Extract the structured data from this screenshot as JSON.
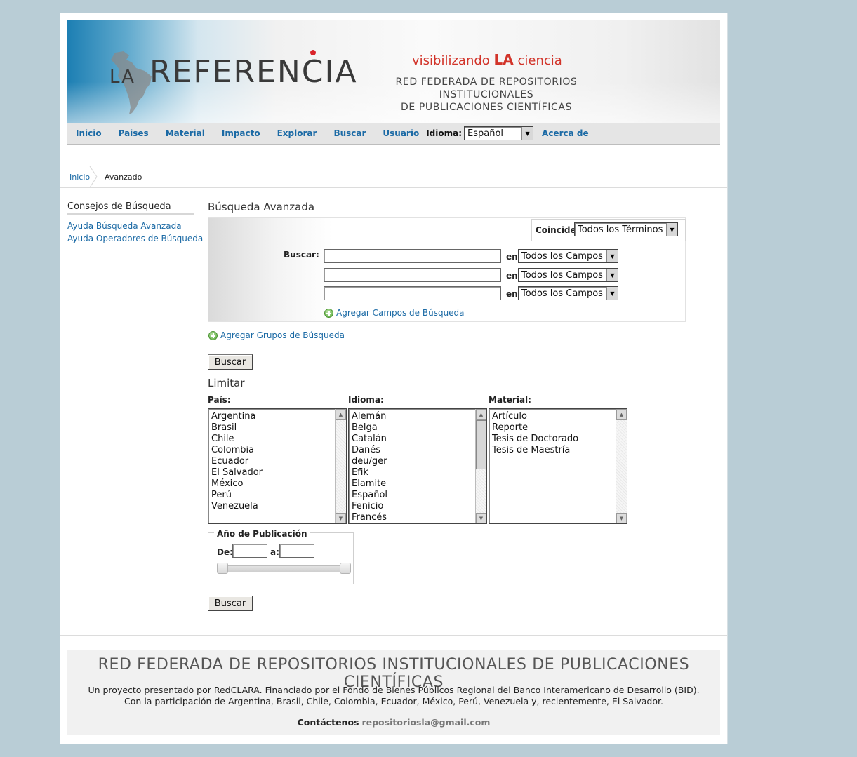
{
  "header": {
    "logo_la": "LA",
    "logo_ref": "REFERENCIA",
    "tagline_a": "visibilizando ",
    "tagline_la": "LA",
    "tagline_b": " ciencia",
    "subtitle_1": "RED FEDERADA DE REPOSITORIOS INSTITUCIONALES",
    "subtitle_2": "DE PUBLICACIONES CIENTÍFICAS",
    "accent_color": "#d2342a"
  },
  "nav": {
    "items": [
      "Inicio",
      "Paises",
      "Material",
      "Impacto",
      "Explorar",
      "Buscar",
      "Usuario"
    ],
    "language_label": "Idioma:",
    "language_value": "Español",
    "about": "Acerca de"
  },
  "breadcrumb": {
    "home": "Inicio",
    "current": "Avanzado"
  },
  "sidebar": {
    "title": "Consejos de Búsqueda",
    "links": [
      "Ayuda Búsqueda Avanzada",
      "Ayuda Operadores de Búsqueda"
    ]
  },
  "search": {
    "title": "Búsqueda Avanzada",
    "coincide_label": "Coincide:",
    "coincide_value": "Todos los Términos",
    "buscar_label": "Buscar:",
    "in_label": "en",
    "field_value": "Todos los Campos",
    "add_fields": "Agregar Campos de Búsqueda",
    "add_groups": "Agregar Grupos de Búsqueda",
    "button": "Buscar"
  },
  "limit": {
    "title": "Limitar",
    "pais_label": "País:",
    "pais": [
      "Argentina",
      "Brasil",
      "Chile",
      "Colombia",
      "Ecuador",
      "El Salvador",
      "México",
      "Perú",
      "Venezuela"
    ],
    "idioma_label": "Idioma:",
    "idioma": [
      "Alemán",
      "Belga",
      "Catalán",
      "Danés",
      "deu/ger",
      "Efik",
      "Elamite",
      "Español",
      "Fenicio",
      "Francés"
    ],
    "material_label": "Material:",
    "material": [
      "Artículo",
      "Reporte",
      "Tesis de Doctorado",
      "Tesis de Maestría"
    ],
    "year_legend": "Año de Publicación",
    "from_label": "De:",
    "to_label": "a:",
    "button": "Buscar"
  },
  "footer": {
    "title": "RED FEDERADA DE REPOSITORIOS INSTITUCIONALES DE PUBLICACIONES CIENTÍFICAS",
    "line1": "Un proyecto presentado por RedCLARA. Financiado por el Fondo de Bienes Públicos Regional del Banco Interamericano de Desarrollo (BID).",
    "line2": "Con la participación de Argentina, Brasil, Chile, Colombia, Ecuador, México, Perú, Venezuela y, recientemente, El Salvador.",
    "contact_label": "Contáctenos",
    "email": "repositoriosla@gmail.com"
  }
}
